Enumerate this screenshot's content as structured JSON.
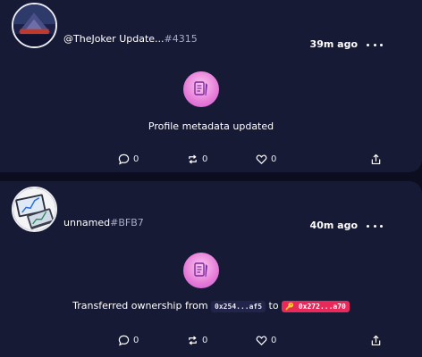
{
  "posts": [
    {
      "user_handle": "@TheJoker Update...",
      "user_tag": "#4315",
      "time": "39m ago",
      "message": "Profile metadata updated",
      "comments": "0",
      "reposts": "0",
      "likes": "0"
    },
    {
      "user_handle": "unnamed",
      "user_tag": "#BFB7",
      "time": "40m ago",
      "message_prefix": "Transferred ownership from",
      "from_address": "0x254...af5",
      "to_word": "to",
      "to_address": "🔑 0x272...a70",
      "comments": "0",
      "reposts": "0",
      "likes": "0"
    }
  ],
  "colors": {
    "background": "#0c0e1f",
    "card": "#171a35",
    "accent_pink": "#e8295a",
    "badge": "#e67ad8"
  }
}
